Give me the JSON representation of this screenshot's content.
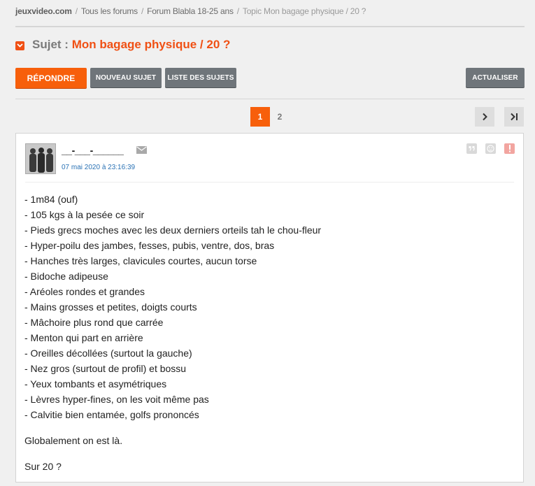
{
  "breadcrumb": {
    "items": [
      "jeuxvideo.com",
      "Tous les forums",
      "Forum Blabla 18-25 ans"
    ],
    "current": "Topic Mon bagage physique / 20 ?"
  },
  "subject": {
    "prefix": "Sujet :",
    "title": "Mon bagage physique / 20 ?"
  },
  "toolbar": {
    "reply_label": "RÉPONDRE",
    "new_subject_label": "NOUVEAU SUJET",
    "list_label": "LISTE DES SUJETS",
    "refresh_label": "ACTUALISER"
  },
  "pagination": {
    "pages": [
      "1",
      "2"
    ],
    "current": "1"
  },
  "post": {
    "author": "__-___-______",
    "date": "07 mai 2020 à 23:16:39",
    "lines": [
      "- 1m84 (ouf)",
      "- 105 kgs à la pesée ce soir",
      "- Pieds grecs moches avec les deux derniers orteils tah le chou-fleur",
      "- Hyper-poilu des jambes, fesses, pubis, ventre, dos, bras",
      "- Hanches très larges, clavicules courtes, aucun torse",
      "- Bidoche adipeuse",
      "- Aréoles rondes et grandes",
      "- Mains grosses et petites, doigts courts",
      "- Mâchoire plus rond que carrée",
      "- Menton qui part en arrière",
      "- Oreilles décollées (surtout la gauche)",
      "- Nez gros (surtout de profil) et bossu",
      "- Yeux tombants et asymétriques",
      "- Lèvres hyper-fines, on les voit même pas",
      "- Calvitie bien entamée, golfs prononcés"
    ],
    "paragraph_1": "Globalement on est là.",
    "paragraph_2": "Sur 20 ?"
  },
  "colors": {
    "accent": "#f75f0b",
    "link": "#2a72b5",
    "button_gray": "#6f757a"
  },
  "icons": [
    "chevron-down-icon",
    "mail-icon",
    "quote-icon",
    "blacklist-icon",
    "report-icon",
    "next-page-icon",
    "last-page-icon"
  ]
}
